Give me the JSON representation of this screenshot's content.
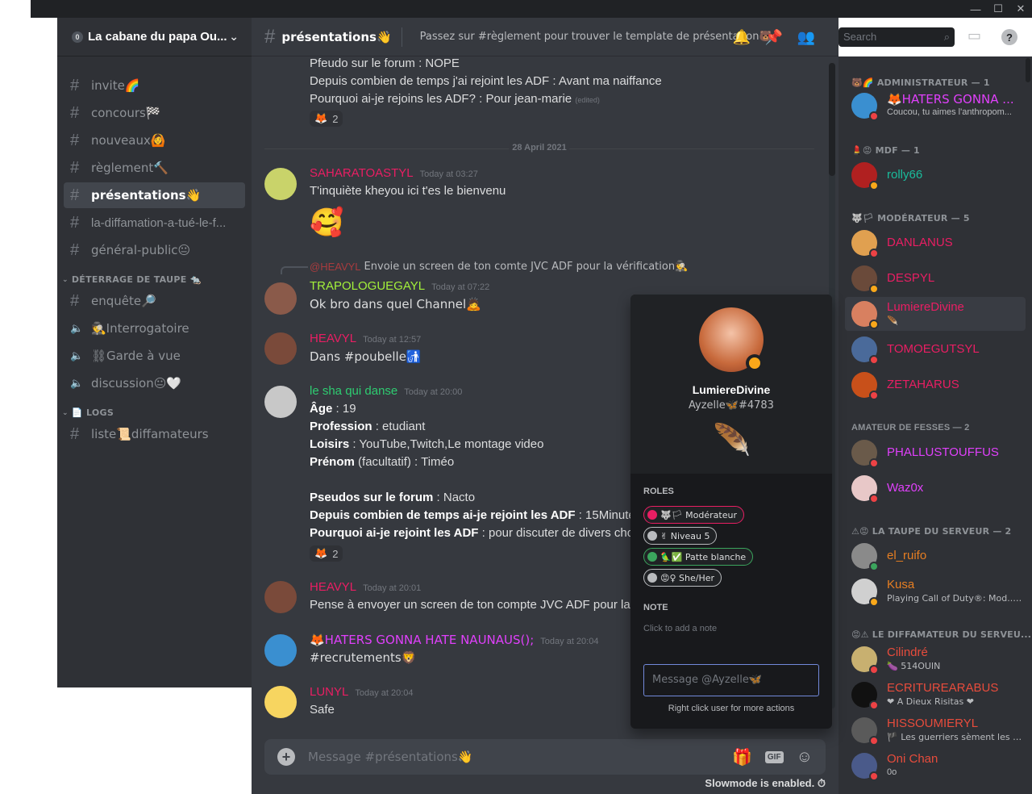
{
  "window": {
    "minimize": "—",
    "maximize": "☐",
    "close": "✕"
  },
  "server": {
    "name": "La cabane du papa Ou...",
    "badge": "0"
  },
  "channels": [
    {
      "label": "invite🌈",
      "kind": "text"
    },
    {
      "label": "concours🏁",
      "kind": "text"
    },
    {
      "label": "nouveaux🙆",
      "kind": "text"
    },
    {
      "label": "règlement🔨",
      "kind": "text"
    },
    {
      "label": "présentations👋",
      "kind": "text",
      "active": true
    },
    {
      "label": "la-diffamation-a-tué-le-f...",
      "kind": "text"
    },
    {
      "label": "général-public😐",
      "kind": "text"
    }
  ],
  "category1": {
    "name": "DÉTERRAGE DE TAUPE 🐀",
    "channels": [
      {
        "label": "enquête🔎",
        "kind": "text"
      },
      {
        "label": "🕵Interrogatoire",
        "kind": "voice"
      },
      {
        "label": "⛓Garde à vue",
        "kind": "voice"
      },
      {
        "label": "discussion😐🤍",
        "kind": "voice"
      }
    ]
  },
  "category2": {
    "name": "📄 LOGS",
    "channels": [
      {
        "label": "liste📜diffamateurs",
        "kind": "text"
      }
    ]
  },
  "chat": {
    "channel": "présentations👋",
    "topic": "Passez sur #règlement pour trouver le template de présentation🐻",
    "search_placeholder": "Search",
    "composer_placeholder": "Message #présentations👋",
    "slowmode": "Slowmode is enabled.",
    "date_divider": "28 April 2021",
    "top_lines": [
      "Pfeudo sur le forum : NOPE",
      "Depuis combien de temps j'ai rejoint les ADF : Avant ma naiffance",
      "Pourquoi ai-je rejoins les ADF? : Pour jean-marie"
    ],
    "edited": "(edited)",
    "reaction1": {
      "emoji": "🦊",
      "count": "2"
    },
    "messages": [
      {
        "user": "SAHARATOASTYL",
        "color": "#e91e63",
        "time": "Today at 03:27",
        "text": "T'inquiète kheyou ici t'es le bienvenu",
        "sticker": "🥰"
      },
      {
        "reply_mention": "@HEAVYL",
        "reply_text": "Envoie un screen de ton comte JVC ADF pour la vérification🕵",
        "user": "TRAPOLOGUEGAYL",
        "color": "#a3f13a",
        "time": "Today at 07:22",
        "text": "Ok bro dans quel Channel🙇"
      },
      {
        "user": "HEAVYL",
        "color": "#e91e63",
        "time": "Today at 12:57",
        "text": "Dans #poubelle🚮"
      },
      {
        "user": "le sha qui danse",
        "color": "#2ecc71",
        "time": "Today at 20:00",
        "fields": [
          {
            "k": "Âge",
            "v": " : 19"
          },
          {
            "k": "Profession",
            "v": " : etudiant"
          },
          {
            "k": "Loisirs",
            "v": " : YouTube,Twitch,Le montage video"
          },
          {
            "k": "Prénom",
            "v": " (facultatif) : Timéo",
            "kplain": true
          },
          {
            "k": "Pseudos sur le forum",
            "v": " : Nacto"
          },
          {
            "k": "Depuis combien de temps ai-je rejoint les ADF",
            "v": " : 15Minute"
          },
          {
            "k": "Pourquoi ai-je rejoint les ADF",
            "v": " : pour  discuter de divers chos"
          }
        ],
        "reaction": {
          "emoji": "🦊",
          "count": "2"
        }
      },
      {
        "user": "HEAVYL",
        "color": "#e91e63",
        "time": "Today at 20:01",
        "text": "Pense à envoyer un screen de ton compte JVC ADF pour la v"
      },
      {
        "user": "🦊HATERS GONNA HATE NAUNAUS();",
        "color": "#e040fb",
        "time": "Today at 20:04",
        "text": "#recrutements🦁"
      },
      {
        "user": "LUNYL",
        "color": "#e91e63",
        "time": "Today at 20:04",
        "text": "Safe"
      }
    ]
  },
  "members": {
    "groups": [
      {
        "title": "🐻🌈 ADMINISTRATEUR — 1",
        "items": [
          {
            "name": "🦊HATERS GONNA ...",
            "sub": "Coucou, tu aimes l'anthropom...",
            "color": "#e040fb",
            "status": "#ed4245"
          }
        ]
      },
      {
        "title": "💄😡 MDF — 1",
        "items": [
          {
            "name": "rolly66",
            "color": "#1abc9c",
            "status": "#faa81a"
          }
        ]
      },
      {
        "title": "🐺🏳 MODÉRATEUR — 5",
        "items": [
          {
            "name": "DANLANUS",
            "color": "#e91e63",
            "status": "#ed4245"
          },
          {
            "name": "DESPYL",
            "color": "#e91e63",
            "status": "#faa81a"
          },
          {
            "name": "LumiereDivine",
            "sub": "🪶",
            "color": "#e91e63",
            "status": "#faa81a",
            "hover": true
          },
          {
            "name": "TOMOEGUTSYL",
            "color": "#e91e63",
            "status": "#ed4245"
          },
          {
            "name": "ZETAHARUS",
            "color": "#e91e63",
            "status": "#ed4245"
          }
        ]
      },
      {
        "title": "AMATEUR DE FESSES — 2",
        "items": [
          {
            "name": "PHALLUSTOUFFUS",
            "color": "#e040fb",
            "status": "#ed4245"
          },
          {
            "name": "Waz0x",
            "color": "#e040fb",
            "status": "#ed4245"
          }
        ]
      },
      {
        "title": "⚠😡 LA TAUPE DU SERVEUR — 2",
        "items": [
          {
            "name": "el_ruifo",
            "color": "#e67e22",
            "status": "#3ba55d"
          },
          {
            "name": "Kusa",
            "sub": "Playing Call of Duty®: Mod... 🖥",
            "color": "#e67e22",
            "status": "#faa81a"
          }
        ]
      },
      {
        "title": "😡⚠ LE DIFFAMATEUR DU SERVEU...",
        "items": [
          {
            "name": "Cilindré",
            "sub": "🍆 514OUIN",
            "color": "#e74c3c",
            "status": "#ed4245"
          },
          {
            "name": "ECRITUREARABUS",
            "sub": "❤ A Dieux Risitas ❤",
            "color": "#e74c3c",
            "status": "#ed4245"
          },
          {
            "name": "HISSOUMIERYL",
            "sub": "🏴 Les guerriers sèment les rê...",
            "color": "#e74c3c",
            "status": "#ed4245"
          },
          {
            "name": "Oni Chan",
            "sub": "0o",
            "color": "#e74c3c",
            "status": "#ed4245"
          }
        ]
      }
    ]
  },
  "popout": {
    "name": "LumiereDivine",
    "tag": "Ayzelle🦋#4783",
    "roles_title": "ROLES",
    "roles": [
      {
        "label": "🐺🏳 Modérateur",
        "color": "#e91e63"
      },
      {
        "label": "✌ Niveau 5",
        "color": "#b9bbbe"
      },
      {
        "label": "🦜✅ Patte blanche",
        "color": "#3ba55d"
      },
      {
        "label": "😡♀ She/Her",
        "color": "#b9bbbe"
      }
    ],
    "note_title": "NOTE",
    "note_placeholder": "Click to add a note",
    "message_placeholder": "Message @Ayzelle🦋",
    "hint": "Right click user for more actions"
  }
}
